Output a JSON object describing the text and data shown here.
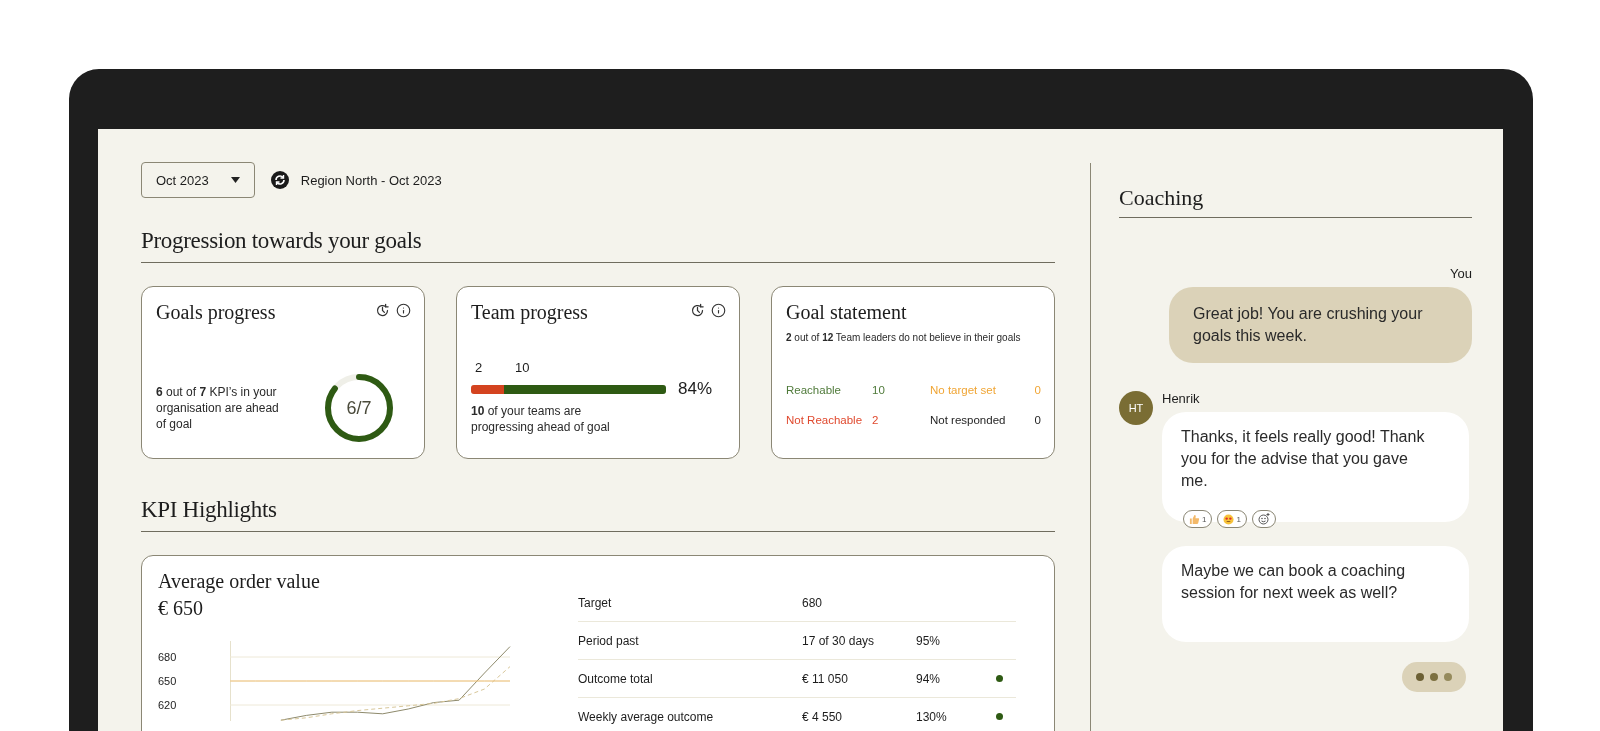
{
  "filter": {
    "period": "Oct 2023",
    "context": "Region North -  Oct 2023"
  },
  "progression": {
    "title": "Progression towards your goals",
    "goals_progress": {
      "title": "Goals progress",
      "text": "**6** out of **7** KPI’s in your organisation are ahead of goal",
      "ring_label": "6/7",
      "level": 0.857
    },
    "team_progress": {
      "title": "Team progress",
      "segments": [
        {
          "label": "2",
          "level": 0.17,
          "color": "#d4431f"
        },
        {
          "label": "10",
          "level": 0.83,
          "color": "#2e5a13"
        }
      ],
      "percent": "84%",
      "text": "**10** of your teams are progressing ahead of goal"
    },
    "goal_statement": {
      "title": "Goal statement",
      "text": "**2** out of **12** Team leaders do not believe in their goals",
      "stats": [
        {
          "label": "Reachable",
          "value": "10",
          "color": "#4f7a3a"
        },
        {
          "label": "No target set",
          "value": "0",
          "color": "#f0a534"
        },
        {
          "label": "Not Reachable",
          "value": "2",
          "color": "#e0492e"
        },
        {
          "label": "Not responded",
          "value": "0",
          "color": "#1f1f1f"
        }
      ]
    }
  },
  "kpi": {
    "title": "KPI Highlights",
    "card": {
      "title": "Average order value",
      "value": "€ 650",
      "chart_data": {
        "type": "line",
        "ylim": [
          600,
          700
        ],
        "yticks": [
          620,
          650,
          680
        ],
        "grid": true,
        "series": [
          {
            "color": "#8e8a6c",
            "values": [
              null,
              null,
              601,
              607,
              611,
              611,
              609,
              615,
              623,
              626,
              660,
              693
            ]
          },
          {
            "color": "#d8c79a",
            "line_style": "dashed",
            "values": [
              null,
              null,
              601,
              604,
              609,
              613,
              616,
              619,
              622,
              628,
              640,
              668
            ]
          },
          {
            "color": "#f0c27a",
            "values": [
              650,
              650,
              650,
              650,
              650,
              650,
              650,
              650,
              650,
              650,
              650,
              650
            ]
          }
        ]
      },
      "rows": [
        {
          "label": "Target",
          "value": "680"
        },
        {
          "label": "Period past",
          "value": "17 of 30 days",
          "percent": "95%"
        },
        {
          "label": "Outcome total",
          "value": "€ 11 050",
          "percent": "94%",
          "color": "#2e5a13"
        },
        {
          "label": "Weekly average outcome",
          "value": "€ 4 550",
          "percent": "130%",
          "color": "#2e5a13"
        }
      ]
    }
  },
  "coaching": {
    "title": "Coaching",
    "messages": [
      {
        "kind": "outgoing",
        "sender": "You",
        "text": "Great job! You are crushing your goals this week."
      },
      {
        "kind": "incoming",
        "sender": "Henrik",
        "initials": "HT",
        "text": "Thanks, it feels really good! Thank you for the advise that you gave me.",
        "reactions": [
          {
            "kind": "thumbs",
            "count": "1"
          },
          {
            "kind": "star-eyes",
            "count": "1"
          }
        ]
      },
      {
        "kind": "incoming",
        "text": "Maybe we can book a coaching session for next week as well?"
      }
    ],
    "typing": true
  }
}
